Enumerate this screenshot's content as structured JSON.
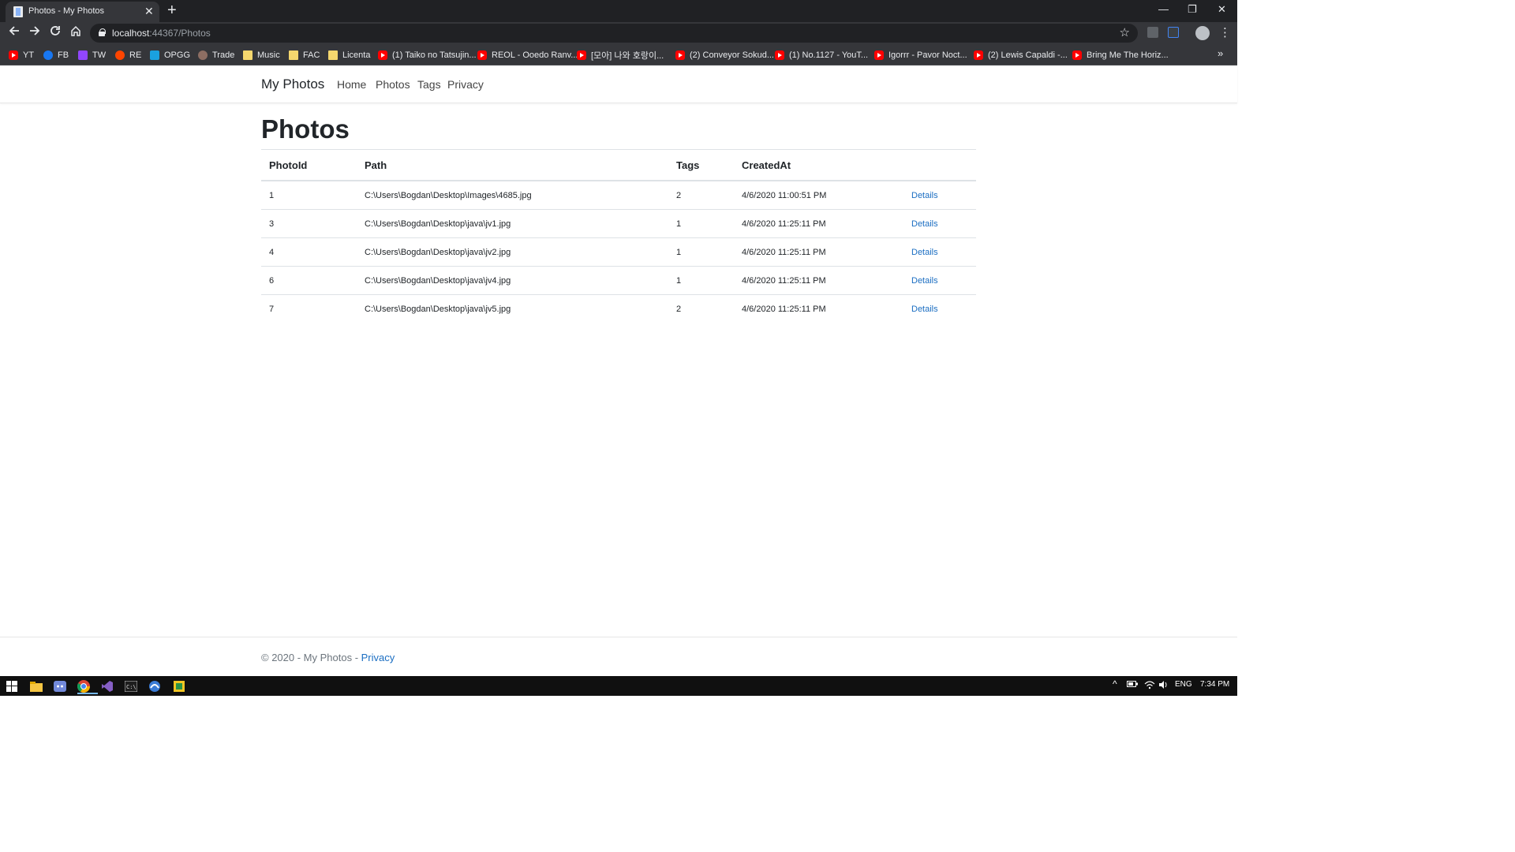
{
  "browser": {
    "tab_title": "Photos - My Photos",
    "tab_close": "✕",
    "new_tab": "+",
    "window_controls": [
      "—",
      "❐",
      "✕"
    ],
    "url_host": "localhost",
    "url_rest": ":44367/Photos",
    "bookmarks": [
      {
        "label": "YT",
        "icon": "youtube-icon"
      },
      {
        "label": "FB",
        "icon": "facebook-icon"
      },
      {
        "label": "TW",
        "icon": "twitch-icon"
      },
      {
        "label": "RE",
        "icon": "reddit-icon"
      },
      {
        "label": "OPGG",
        "icon": "opgg-icon"
      },
      {
        "label": "Trade",
        "icon": "trade-icon"
      },
      {
        "label": "Music",
        "icon": "folder-icon"
      },
      {
        "label": "FAC",
        "icon": "folder-icon"
      },
      {
        "label": "Licenta",
        "icon": "folder-icon"
      },
      {
        "label": "(1) Taiko no Tatsujin...",
        "icon": "youtube-icon"
      },
      {
        "label": "REOL - Ooedo Ranv...",
        "icon": "youtube-icon"
      },
      {
        "label": "[모아] 나와 호랑이...",
        "icon": "youtube-icon"
      },
      {
        "label": "(2) Conveyor Sokud...",
        "icon": "youtube-icon"
      },
      {
        "label": "(1) No.1127 - YouT...",
        "icon": "youtube-icon"
      },
      {
        "label": "Igorrr - Pavor Noct...",
        "icon": "youtube-icon"
      },
      {
        "label": "(2) Lewis Capaldi -...",
        "icon": "youtube-icon"
      },
      {
        "label": "Bring Me The Horiz...",
        "icon": "youtube-icon"
      }
    ],
    "bookmarks_more": "»"
  },
  "navbar": {
    "brand": "My Photos",
    "links": [
      "Home",
      "Photos",
      "Tags",
      "Privacy"
    ]
  },
  "page": {
    "title": "Photos",
    "columns": [
      "PhotoId",
      "Path",
      "Tags",
      "CreatedAt"
    ],
    "rows": [
      {
        "id": "1",
        "path": "C:\\Users\\Bogdan\\Desktop\\Images\\4685.jpg",
        "tags": "2",
        "created": "4/6/2020 11:00:51 PM",
        "action": "Details"
      },
      {
        "id": "3",
        "path": "C:\\Users\\Bogdan\\Desktop\\java\\jv1.jpg",
        "tags": "1",
        "created": "4/6/2020 11:25:11 PM",
        "action": "Details"
      },
      {
        "id": "4",
        "path": "C:\\Users\\Bogdan\\Desktop\\java\\jv2.jpg",
        "tags": "1",
        "created": "4/6/2020 11:25:11 PM",
        "action": "Details"
      },
      {
        "id": "6",
        "path": "C:\\Users\\Bogdan\\Desktop\\java\\jv4.jpg",
        "tags": "1",
        "created": "4/6/2020 11:25:11 PM",
        "action": "Details"
      },
      {
        "id": "7",
        "path": "C:\\Users\\Bogdan\\Desktop\\java\\jv5.jpg",
        "tags": "2",
        "created": "4/6/2020 11:25:11 PM",
        "action": "Details"
      }
    ]
  },
  "footer": {
    "text": "© 2020 - My Photos - ",
    "link": "Privacy"
  },
  "taskbar": {
    "language": "ENG",
    "time": "7:34 PM"
  },
  "colors": {
    "link": "#1b6ec2",
    "chrome_dark": "#202124",
    "chrome_toolbar": "#35363a"
  }
}
